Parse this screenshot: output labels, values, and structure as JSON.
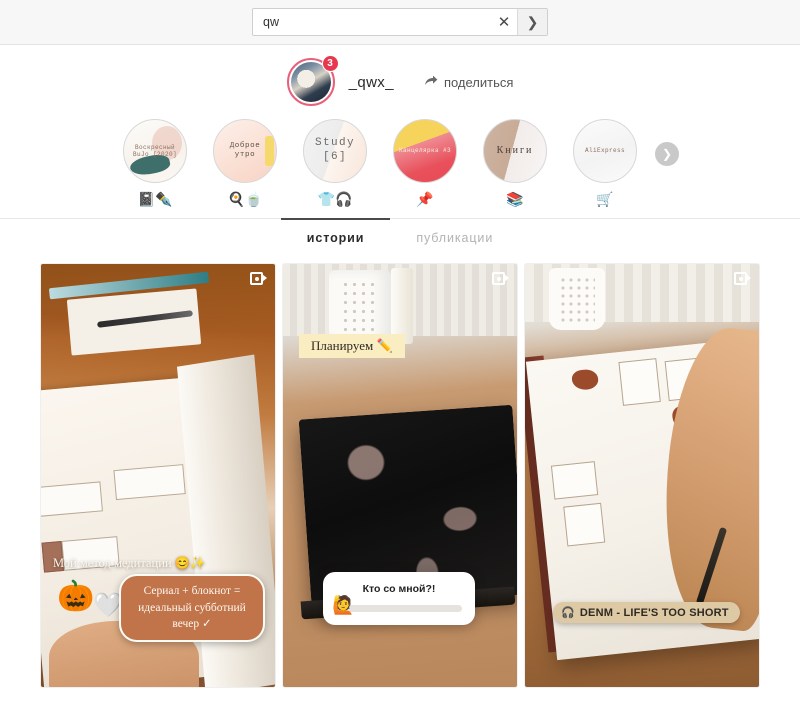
{
  "search": {
    "value": "qw",
    "placeholder": "",
    "clear_icon": "close-icon",
    "go_icon": "chevron-right-icon"
  },
  "profile": {
    "username": "_qwx_",
    "story_badge": "3",
    "share_label": "поделиться",
    "share_icon": "share-arrow-icon",
    "ring_color": "#e8607a",
    "badge_color": "#e8384f"
  },
  "highlights": {
    "items": [
      {
        "label": "Воскресный BuJo [2020]",
        "emoji": "📓✒️",
        "style": "tiny"
      },
      {
        "label": "Доброе утро",
        "emoji": "🍳🍵",
        "style": "dark"
      },
      {
        "label": "Study [6]",
        "emoji": "👕🎧",
        "style": "big"
      },
      {
        "label": "Канцелярка #3",
        "emoji": "📌",
        "style": "white"
      },
      {
        "label": "Книги",
        "emoji": "📚",
        "style": "serif"
      },
      {
        "label": "AliExpress",
        "emoji": "🛒",
        "style": "tiny"
      }
    ],
    "next_icon": "chevron-right-circle-icon"
  },
  "tabs": [
    {
      "label": "истории",
      "active": true
    },
    {
      "label": "публикации",
      "active": false
    }
  ],
  "stories": [
    {
      "media_type_icon": "video-camera-icon",
      "overlay_text": "Мой метод медитации 😊✨",
      "chip_text": "Сериал + блокнот = идеальный субботний вечер ✓",
      "pumpkin_a": "🎃",
      "pumpkin_b": "🤍"
    },
    {
      "media_type_icon": "video-camera-icon",
      "label_text": "Планируем ✏️",
      "slider_question": "Кто со мной?!",
      "slider_emoji": "🙋"
    },
    {
      "media_type_icon": "video-camera-icon",
      "music_icon": "🎧",
      "music_text": "DENM - LIFE'S TOO SHORT"
    }
  ]
}
